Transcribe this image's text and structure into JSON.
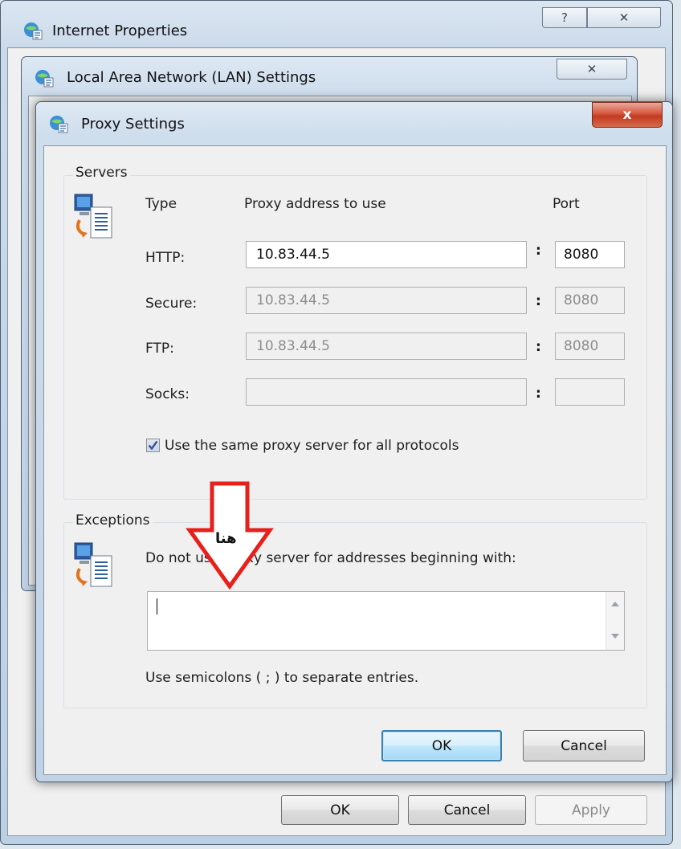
{
  "internet_properties": {
    "title": "Internet Properties",
    "help_glyph": "?",
    "close_glyph": "✕",
    "buttons": {
      "ok": "OK",
      "cancel": "Cancel",
      "apply": "Apply"
    }
  },
  "lan_settings": {
    "title": "Local Area Network (LAN) Settings",
    "close_glyph": "✕"
  },
  "proxy_settings": {
    "title": "Proxy Settings",
    "close_glyph": "x",
    "servers": {
      "group_title": "Servers",
      "headers": {
        "type": "Type",
        "address": "Proxy address to use",
        "port": "Port"
      },
      "rows": [
        {
          "label": "HTTP:",
          "address": "10.83.44.5",
          "port": "8080",
          "enabled": true
        },
        {
          "label": "Secure:",
          "address": "10.83.44.5",
          "port": "8080",
          "enabled": false
        },
        {
          "label": "FTP:",
          "address": "10.83.44.5",
          "port": "8080",
          "enabled": false
        },
        {
          "label": "Socks:",
          "address": "",
          "port": "",
          "enabled": false
        }
      ],
      "colon": ":",
      "same_proxy_checkbox": {
        "label": "Use the same proxy server for all protocols",
        "checked": true
      }
    },
    "exceptions": {
      "group_title": "Exceptions",
      "description": "Do not use proxy server for addresses beginning with:",
      "value": "",
      "hint": "Use semicolons ( ; ) to separate entries."
    },
    "buttons": {
      "ok": "OK",
      "cancel": "Cancel"
    }
  },
  "annotation": {
    "text": "هنا",
    "color": "#e8201c"
  }
}
